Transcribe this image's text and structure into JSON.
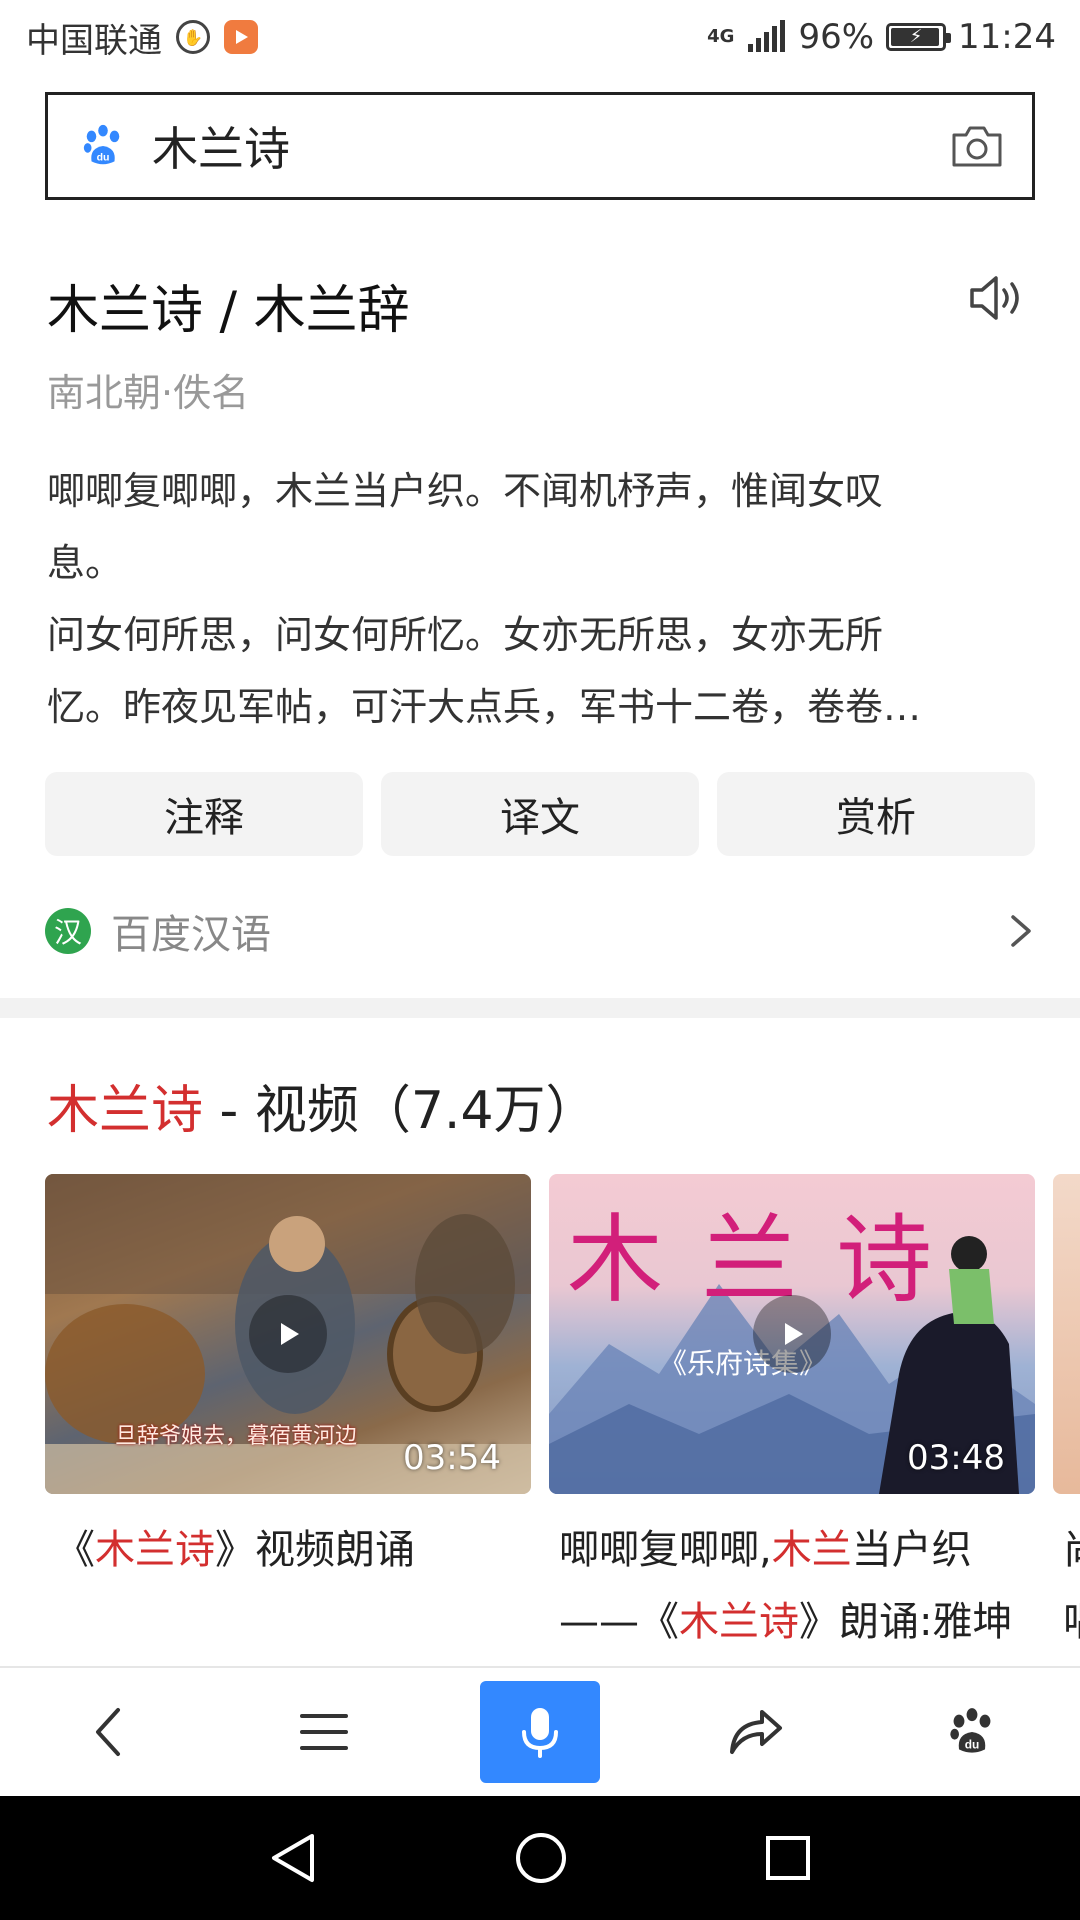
{
  "status_bar": {
    "carrier": "中国联通",
    "network": "4G",
    "battery": "96%",
    "battery_level": 0.96,
    "time": "11:24"
  },
  "search": {
    "query": "木兰诗",
    "logo_icon": "baidu-paw-icon",
    "camera_icon": "camera-icon"
  },
  "poem": {
    "title": "木兰诗 / 木兰辞",
    "author": "南北朝·佚名",
    "lines": [
      "唧唧复唧唧，木兰当户织。不闻机杼声，惟闻女叹",
      "息。",
      "问女何所思，问女何所忆。女亦无所思，女亦无所",
      "忆。昨夜见军帖，可汗大点兵，军书十二卷，卷卷…"
    ],
    "actions": [
      "注释",
      "译文",
      "赏析"
    ],
    "source": "百度汉语",
    "source_badge": "汉"
  },
  "videos": {
    "title_highlight": "木兰诗",
    "title_rest": " - 视频（7.4万）",
    "items": [
      {
        "duration": "03:54",
        "caption": "旦辞爷娘去，暮宿黄河边",
        "title_parts": [
          "《",
          "木兰诗",
          "》视频朗诵"
        ],
        "title_line2_parts": []
      },
      {
        "duration": "03:48",
        "thumb_title": "木 兰 诗",
        "thumb_subtitle": "《乐府诗集》",
        "title_parts": [
          "唧唧复唧唧,",
          "木兰",
          "当户织"
        ],
        "title_line2_parts": [
          "——《",
          "木兰诗",
          "》朗诵:雅坤"
        ]
      },
      {
        "title_parts": [
          "尚"
        ],
        "title_line2_parts": [
          "唱"
        ]
      }
    ]
  },
  "toolbar": {
    "items": [
      "back-icon",
      "menu-icon",
      "microphone-icon",
      "share-icon",
      "baidu-paw-icon"
    ]
  },
  "colors": {
    "highlight": "#d32f2f",
    "accent_blue": "#3388ff",
    "badge_green": "#2fa44f"
  }
}
